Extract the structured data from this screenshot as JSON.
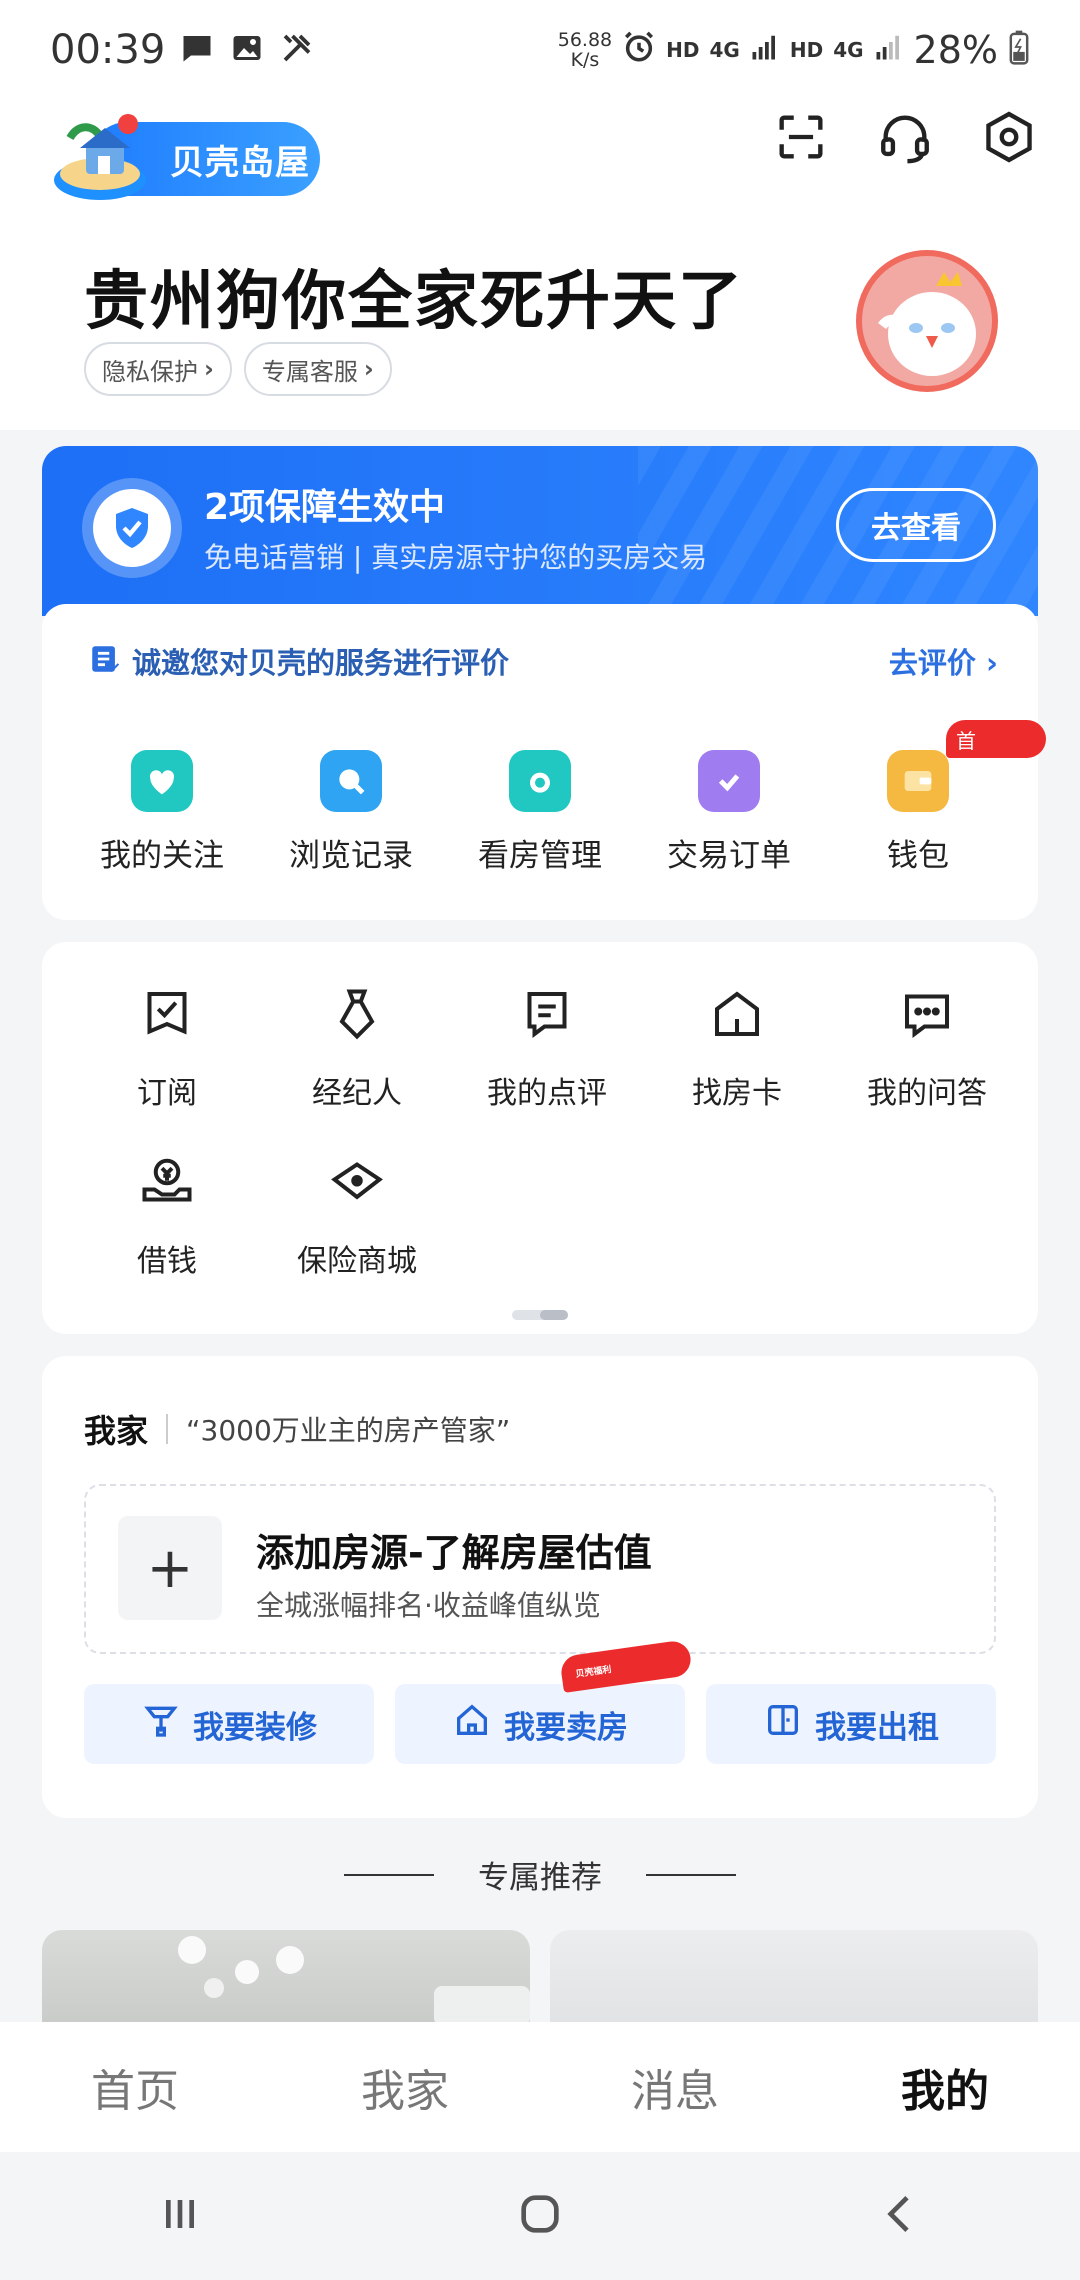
{
  "status_bar": {
    "time": "00:39",
    "net_speed": "56.88",
    "net_unit": "K/s",
    "hd1": "HD",
    "net1": "4G",
    "hd2": "HD",
    "net2": "4G",
    "battery": "28%"
  },
  "header": {
    "logo_text": "贝壳岛屋",
    "icons": [
      "scan-icon",
      "headset-icon",
      "settings-icon"
    ]
  },
  "profile": {
    "name": "贵州狗你全家死升天了",
    "chips": [
      "隐私保护",
      "专属客服"
    ]
  },
  "guarantee": {
    "title": "2项保障生效中",
    "subtitle": "免电话营销 | 真实房源守护您的买房交易",
    "button": "去查看"
  },
  "service": {
    "rate_text": "诚邀您对贝壳的服务进行评价",
    "rate_link": "去评价",
    "quick_items": [
      {
        "label": "我的关注",
        "icon": "heart-house-icon",
        "color": "#21c7c1"
      },
      {
        "label": "浏览记录",
        "icon": "search-bubble-icon",
        "color": "#2ea4f2"
      },
      {
        "label": "看房管理",
        "icon": "folder-eye-icon",
        "color": "#21c7c1"
      },
      {
        "label": "交易订单",
        "icon": "clipboard-check-icon",
        "color": "#9f7cf0"
      },
      {
        "label": "钱包",
        "icon": "wallet-icon",
        "color": "#f5b942"
      }
    ],
    "wallet_badge": "首"
  },
  "tools": {
    "items": [
      {
        "label": "订阅",
        "icon": "subscribe-icon"
      },
      {
        "label": "经纪人",
        "icon": "agent-tie-icon"
      },
      {
        "label": "我的点评",
        "icon": "comment-icon"
      },
      {
        "label": "找房卡",
        "icon": "house-card-icon"
      },
      {
        "label": "我的问答",
        "icon": "qa-bubble-icon"
      },
      {
        "label": "借钱",
        "icon": "loan-hand-icon"
      },
      {
        "label": "保险商城",
        "icon": "insurance-eye-icon"
      }
    ]
  },
  "home": {
    "title": "我家",
    "slogan": "“3000万业主的房产管家”",
    "add_title": "添加房源-了解房屋估值",
    "add_sub": "全城涨幅排名·收益峰值纵览",
    "actions": [
      "我要装修",
      "我要卖房",
      "我要出租"
    ],
    "sell_tag": "贝壳福利"
  },
  "recommend": {
    "title": "专属推荐"
  },
  "tabs": [
    "首页",
    "我家",
    "消息",
    "我的"
  ],
  "active_tab": "我的",
  "colors": {
    "brand_blue": "#1d6ff5",
    "accent_red": "#ec2c2c",
    "link_blue": "#2465d6"
  }
}
